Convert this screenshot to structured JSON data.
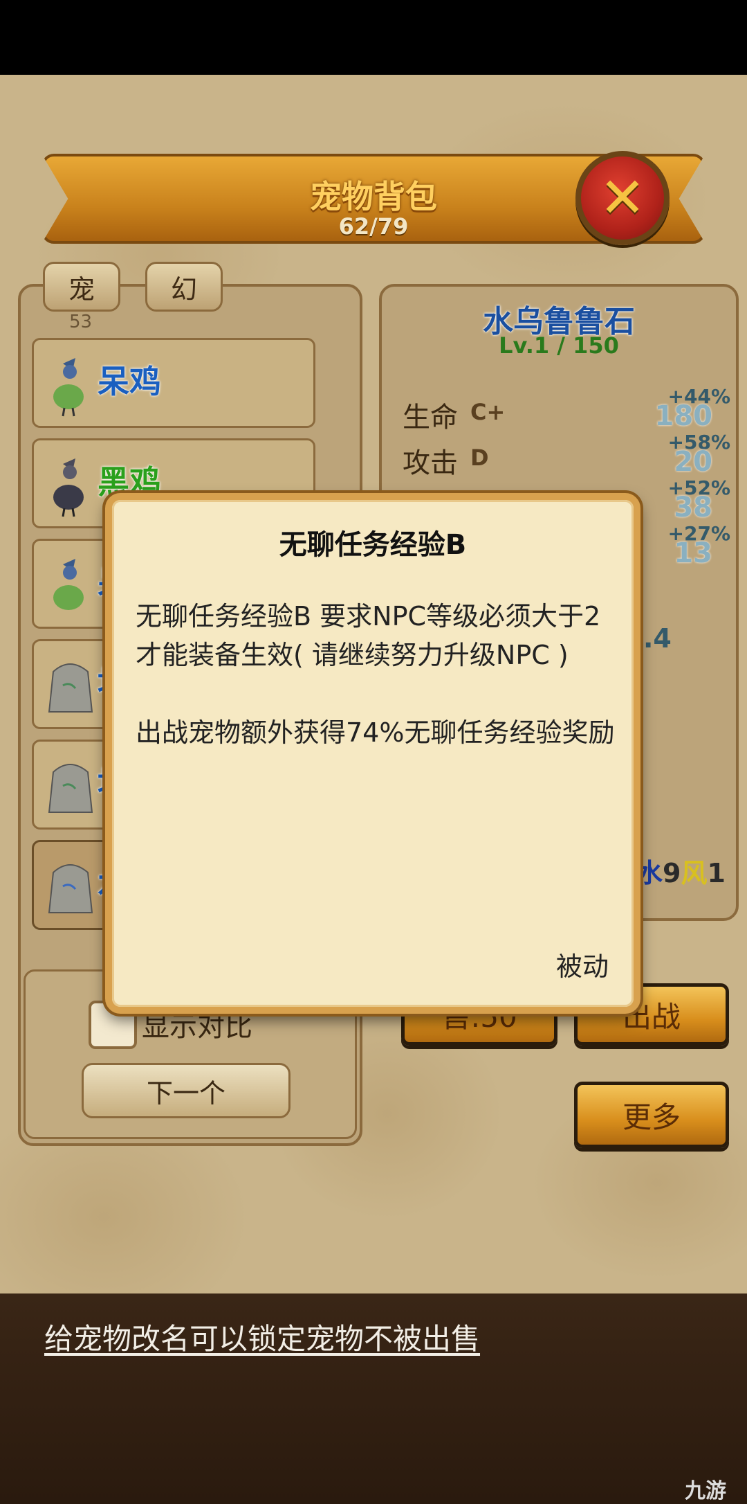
{
  "header": {
    "title": "宠物背包",
    "count": "62/79",
    "close_icon": "close-x-icon"
  },
  "tabs": [
    {
      "label": "宠"
    },
    {
      "label": "幻"
    }
  ],
  "tab_count": "53",
  "pets": [
    {
      "name": "呆鸡",
      "color": "#1a5fc0",
      "icon": "bird-icon"
    },
    {
      "name": "黑鸡",
      "color": "#2aa01c",
      "icon": "dark-bird-icon"
    },
    {
      "name": "呆",
      "color": "#1a5fc0",
      "icon": "bird-icon"
    },
    {
      "name": "地",
      "color": "#1a5fc0",
      "icon": "stone-icon"
    },
    {
      "name": "地",
      "color": "#1a5fc0",
      "icon": "stone-icon"
    },
    {
      "name": "水",
      "color": "#1a5fc0",
      "icon": "stone-icon"
    }
  ],
  "detail": {
    "name": "水乌鲁鲁石",
    "level": "Lv.1 / 150",
    "stats": [
      {
        "label": "生命",
        "grade": "C+",
        "pct": "+44%",
        "value": "180"
      },
      {
        "label": "攻击",
        "grade": "D",
        "pct": "+58%",
        "value": "20"
      },
      {
        "label": "",
        "grade": "",
        "pct": "+52%",
        "value": "38"
      },
      {
        "label": "",
        "grade": "",
        "pct": "+27%",
        "value": "13"
      }
    ],
    "misc_value": ".4",
    "element_water": "水",
    "element_water_val": "9",
    "element_wind": "风",
    "element_wind_val": "1"
  },
  "buttons": {
    "sell": "售:50",
    "battle": "出战",
    "more": "更多",
    "next": "下一个",
    "show_compare": "显示对比"
  },
  "modal": {
    "title": "无聊任务经验B",
    "requirement": "无聊任务经验B 要求NPC等级必须大于2 才能装备生效( 请继续努力升级NPC )",
    "effect": "出战宠物额外获得74%无聊任务经验奖励",
    "type": "被动"
  },
  "tip": "给宠物改名可以锁定宠物不被出售",
  "watermark": "九游"
}
